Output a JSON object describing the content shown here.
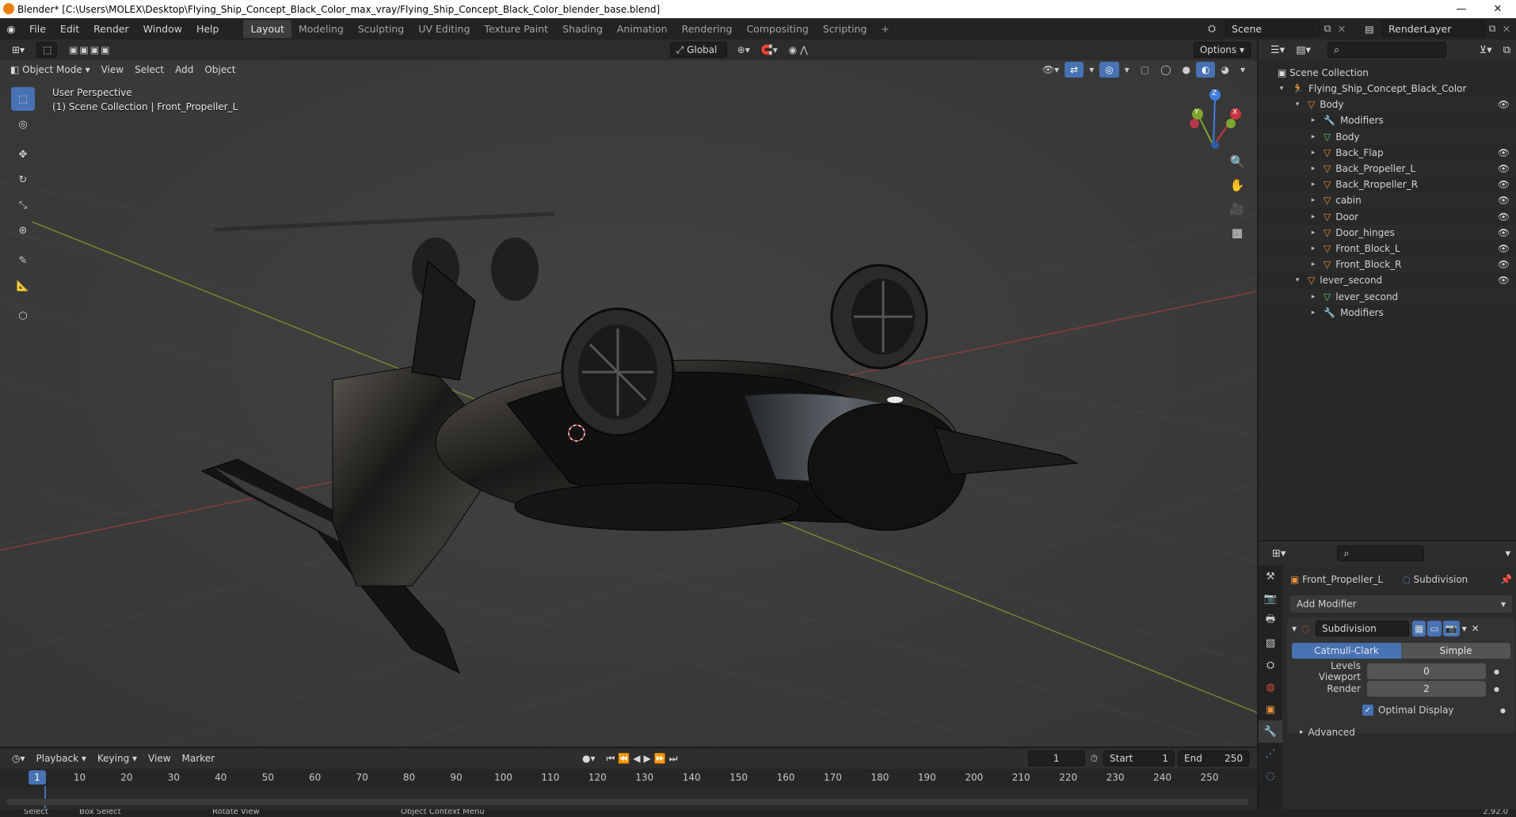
{
  "window": {
    "title": "Blender* [C:\\Users\\MOLEX\\Desktop\\Flying_Ship_Concept_Black_Color_max_vray/Flying_Ship_Concept_Black_Color_blender_base.blend]",
    "minimize": "—",
    "restore": "❐",
    "close": "✕"
  },
  "menu": {
    "items": [
      "File",
      "Edit",
      "Render",
      "Window",
      "Help"
    ],
    "workspaces": [
      "Layout",
      "Modeling",
      "Sculpting",
      "UV Editing",
      "Texture Paint",
      "Shading",
      "Animation",
      "Rendering",
      "Compositing",
      "Scripting"
    ],
    "active_workspace": "Layout",
    "add_workspace": "+",
    "scene_label": "Scene",
    "render_layer_label": "RenderLayer"
  },
  "viewport": {
    "transform_orientation": "Global",
    "options_label": "Options",
    "mode": "Object Mode",
    "menus": [
      "View",
      "Select",
      "Add",
      "Object"
    ],
    "perspective_label": "User Perspective",
    "collection_label": "(1) Scene Collection | Front_Propeller_L",
    "gizmo": {
      "x": "X",
      "y": "Y",
      "z": "Z"
    }
  },
  "outliner": {
    "root": "Scene Collection",
    "rows": [
      {
        "label": "Flying_Ship_Concept_Black_Color",
        "indent": 0,
        "icon": "armature-icon",
        "expanded": true,
        "eye": false
      },
      {
        "label": "Body",
        "indent": 1,
        "icon": "object-icon",
        "expanded": true,
        "eye": true
      },
      {
        "label": "Modifiers",
        "indent": 2,
        "icon": "wrench-icon",
        "expanded": false,
        "eye": false
      },
      {
        "label": "Body",
        "indent": 2,
        "icon": "mesh-icon",
        "expanded": false,
        "eye": false
      },
      {
        "label": "Back_Flap",
        "indent": 2,
        "icon": "object-icon",
        "expanded": false,
        "eye": true
      },
      {
        "label": "Back_Propeller_L",
        "indent": 2,
        "icon": "object-icon",
        "expanded": false,
        "eye": true
      },
      {
        "label": "Back_Rropeller_R",
        "indent": 2,
        "icon": "object-icon",
        "expanded": false,
        "eye": true
      },
      {
        "label": "cabin",
        "indent": 2,
        "icon": "object-icon",
        "expanded": false,
        "eye": true
      },
      {
        "label": "Door",
        "indent": 2,
        "icon": "object-icon",
        "expanded": false,
        "eye": true
      },
      {
        "label": "Door_hinges",
        "indent": 2,
        "icon": "object-icon",
        "expanded": false,
        "eye": true
      },
      {
        "label": "Front_Block_L",
        "indent": 2,
        "icon": "object-icon",
        "expanded": false,
        "eye": true
      },
      {
        "label": "Front_Block_R",
        "indent": 2,
        "icon": "object-icon",
        "expanded": false,
        "eye": true
      },
      {
        "label": "lever_second",
        "indent": 1,
        "icon": "object-icon",
        "expanded": true,
        "eye": true
      },
      {
        "label": "lever_second",
        "indent": 2,
        "icon": "mesh-icon",
        "expanded": false,
        "eye": false
      },
      {
        "label": "Modifiers",
        "indent": 2,
        "icon": "wrench-icon",
        "expanded": false,
        "eye": false
      }
    ]
  },
  "properties": {
    "object_name": "Front_Propeller_L",
    "modifier_breadcrumb": "Subdivision",
    "add_modifier": "Add Modifier",
    "modifier_name": "Subdivision",
    "algorithms": [
      "Catmull-Clark",
      "Simple"
    ],
    "active_algorithm": "Catmull-Clark",
    "levels_viewport_label": "Levels Viewport",
    "levels_viewport_value": "0",
    "render_label": "Render",
    "render_value": "2",
    "optimal_display_label": "Optimal Display",
    "optimal_display_checked": true,
    "advanced_label": "Advanced"
  },
  "timeline": {
    "menus": [
      "Playback",
      "Keying",
      "View",
      "Marker"
    ],
    "current_frame": "1",
    "start_label": "Start",
    "start_value": "1",
    "end_label": "End",
    "end_value": "250",
    "ticks": [
      "1",
      "10",
      "20",
      "30",
      "40",
      "50",
      "60",
      "70",
      "80",
      "90",
      "100",
      "110",
      "120",
      "130",
      "140",
      "150",
      "160",
      "170",
      "180",
      "190",
      "200",
      "210",
      "220",
      "230",
      "240",
      "250"
    ]
  },
  "statusbar": {
    "items": [
      "Select",
      "Box Select",
      "Rotate View",
      "Object Context Menu"
    ],
    "version": "2.92.0"
  },
  "colors": {
    "accent": "#4772b3",
    "object_orange": "#e8923a",
    "mesh_green": "#5fc66c",
    "x_axis": "#c8343e",
    "y_axis": "#7ea62e",
    "z_axis": "#3e7fe0"
  }
}
